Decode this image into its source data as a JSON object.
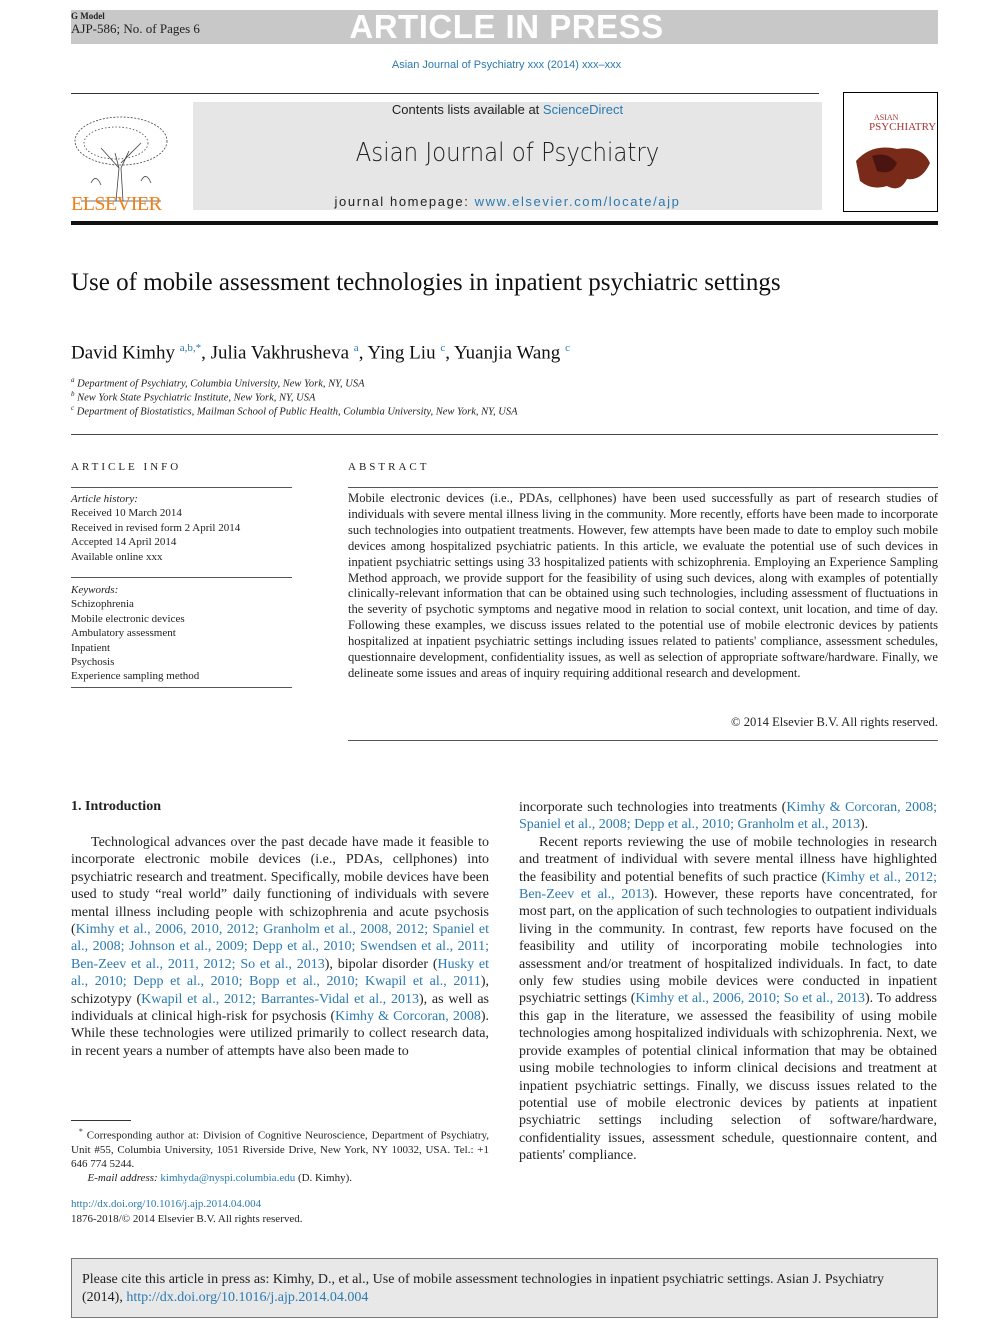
{
  "header": {
    "g_model": "G Model",
    "article_id": "AJP-586; No. of Pages 6",
    "banner": "ARTICLE IN PRESS",
    "journal_ref": "Asian Journal of Psychiatry xxx (2014) xxx–xxx"
  },
  "masthead": {
    "contents_prefix": "Contents lists available at ",
    "sciencedirect": "ScienceDirect",
    "journal_title": "Asian Journal of Psychiatry",
    "homepage_prefix": "journal homepage: ",
    "homepage_url": "www.elsevier.com/locate/ajp",
    "publisher": "ELSEVIER",
    "cover_title_1": "ASIAN",
    "cover_title_2": "PSYCHIATRY",
    "colors": {
      "link": "#2a7ab0",
      "elsevier_orange": "#f07f1a",
      "banner_gray": "#c8c8c8"
    }
  },
  "article": {
    "title": "Use of mobile assessment technologies in inpatient psychiatric settings",
    "authors": [
      {
        "name": "David Kimhy",
        "sup": "a,b,*"
      },
      {
        "name": "Julia Vakhrusheva",
        "sup": "a"
      },
      {
        "name": "Ying Liu",
        "sup": "c"
      },
      {
        "name": "Yuanjia Wang",
        "sup": "c"
      }
    ],
    "affiliations": [
      {
        "sup": "a",
        "text": "Department of Psychiatry, Columbia University, New York, NY, USA"
      },
      {
        "sup": "b",
        "text": "New York State Psychiatric Institute, New York, NY, USA"
      },
      {
        "sup": "c",
        "text": "Department of Biostatistics, Mailman School of Public Health, Columbia University, New York, NY, USA"
      }
    ]
  },
  "article_info": {
    "heading": "ARTICLE INFO",
    "history_label": "Article history:",
    "history": [
      "Received 10 March 2014",
      "Received in revised form 2 April 2014",
      "Accepted 14 April 2014",
      "Available online xxx"
    ],
    "keywords_label": "Keywords:",
    "keywords": [
      "Schizophrenia",
      "Mobile electronic devices",
      "Ambulatory assessment",
      "Inpatient",
      "Psychosis",
      "Experience sampling method"
    ]
  },
  "abstract": {
    "heading": "ABSTRACT",
    "text": "Mobile electronic devices (i.e., PDAs, cellphones) have been used successfully as part of research studies of individuals with severe mental illness living in the community. More recently, efforts have been made to incorporate such technologies into outpatient treatments. However, few attempts have been made to date to employ such mobile devices among hospitalized psychiatric patients. In this article, we evaluate the potential use of such devices in inpatient psychiatric settings using 33 hospitalized patients with schizophrenia. Employing an Experience Sampling Method approach, we provide support for the feasibility of using such devices, along with examples of potentially clinically-relevant information that can be obtained using such technologies, including assessment of fluctuations in the severity of psychotic symptoms and negative mood in relation to social context, unit location, and time of day. Following these examples, we discuss issues related to the potential use of mobile electronic devices by patients hospitalized at inpatient psychiatric settings including issues related to patients' compliance, assessment schedules, questionnaire development, confidentiality issues, as well as selection of appropriate software/hardware. Finally, we delineate some issues and areas of inquiry requiring additional research and development.",
    "copyright": "© 2014 Elsevier B.V. All rights reserved."
  },
  "intro": {
    "heading": "1. Introduction",
    "left_paragraph": [
      {
        "t": "Technological advances over the past decade have made it feasible to incorporate electronic mobile devices (i.e., PDAs, cellphones) into psychiatric research and treatment. Specifically, mobile devices have been used to study “real world” daily functioning of individuals with severe mental illness including people with schizophrenia and acute psychosis ("
      },
      {
        "t": "Kimhy et al., 2006, 2010, 2012; Granholm et al., 2008, 2012; Spaniel et al., 2008; Johnson et al., 2009; Depp et al., 2010; Swendsen et al., 2011; Ben-Zeev et al., 2011, 2012; So et al., 2013",
        "link": true
      },
      {
        "t": "), bipolar disorder ("
      },
      {
        "t": "Husky et al., 2010; Depp et al., 2010; Bopp et al., 2010; Kwapil et al., 2011",
        "link": true
      },
      {
        "t": "), schizotypy ("
      },
      {
        "t": "Kwapil et al., 2012; Barrantes-Vidal et al., 2013",
        "link": true
      },
      {
        "t": "), as well as individuals at clinical high-risk for psychosis ("
      },
      {
        "t": "Kimhy & Corcoran, 2008",
        "link": true
      },
      {
        "t": "). While these technologies were utilized primarily to collect research data, in recent years a number of attempts have also been made to"
      }
    ],
    "right_paragraphs": [
      [
        {
          "t": "incorporate such technologies into treatments ("
        },
        {
          "t": "Kimhy & Corcoran, 2008; Spaniel et al., 2008; Depp et al., 2010; Granholm et al., 2013",
          "link": true
        },
        {
          "t": ")."
        }
      ],
      [
        {
          "t": "Recent reports reviewing the use of mobile technologies in research and treatment of individual with severe mental illness have highlighted the feasibility and potential benefits of such practice ("
        },
        {
          "t": "Kimhy et al., 2012; Ben-Zeev et al., 2013",
          "link": true
        },
        {
          "t": "). However, these reports have concentrated, for most part, on the application of such technologies to outpatient individuals living in the community. In contrast, few reports have focused on the feasibility and utility of incorporating mobile technologies into assessment and/or treatment of hospitalized individuals. In fact, to date only few studies using mobile devices were conducted in inpatient psychiatric settings ("
        },
        {
          "t": "Kimhy et al., 2006, 2010; So et al., 2013",
          "link": true
        },
        {
          "t": "). To address this gap in the literature, we assessed the feasibility of using mobile technologies among hospitalized individuals with schizophrenia. Next, we provide examples of potential clinical information that may be obtained using mobile technologies to inform clinical decisions and treatment at inpatient psychiatric settings. Finally, we discuss issues related to the potential use of mobile electronic devices by patients at inpatient psychiatric settings including selection of software/hardware, confidentiality issues, assessment schedule, questionnaire content, and patients' compliance."
        }
      ]
    ]
  },
  "footnote": {
    "marker": "*",
    "text": "Corresponding author at: Division of Cognitive Neuroscience, Department of Psychiatry, Unit #55, Columbia University, 1051 Riverside Drive, New York, NY 10032, USA. Tel.: +1 646 774 5244.",
    "email_label": "E-mail address:",
    "email": "kimhyda@nyspi.columbia.edu",
    "email_suffix": " (D. Kimhy)."
  },
  "doi": {
    "url": "http://dx.doi.org/10.1016/j.ajp.2014.04.004",
    "copyright": "1876-2018/© 2014 Elsevier B.V. All rights reserved."
  },
  "citation": {
    "text": "Please cite this article in press as: Kimhy, D., et al., Use of mobile assessment technologies in inpatient psychiatric settings. Asian J. Psychiatry (2014), ",
    "url": "http://dx.doi.org/10.1016/j.ajp.2014.04.004"
  }
}
